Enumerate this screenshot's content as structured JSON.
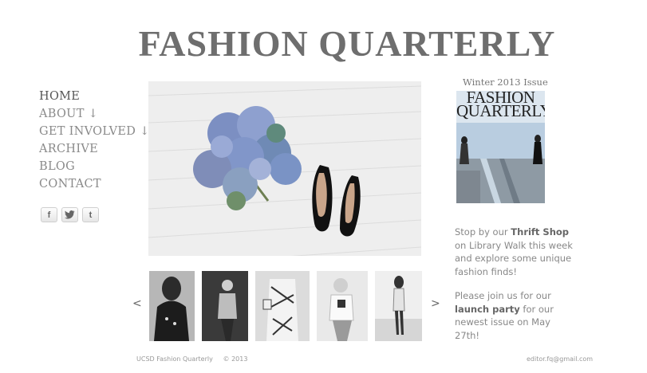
{
  "site": {
    "title": "FASHION QUARTERLY"
  },
  "nav": {
    "items": [
      {
        "label": "HOME"
      },
      {
        "label": "ABOUT ↓"
      },
      {
        "label": "GET INVOLVED ↓"
      },
      {
        "label": "ARCHIVE"
      },
      {
        "label": "BLOG"
      },
      {
        "label": "CONTACT"
      }
    ]
  },
  "social": {
    "facebook": "f",
    "twitter": "t",
    "tumblr": "t"
  },
  "carousel": {
    "prev": "<",
    "next": ">"
  },
  "sidebar": {
    "issue_label": "Winter 2013 Issue",
    "cover_title_line1": "FASHION",
    "cover_title_line2": "QUARTERLY",
    "thrift": {
      "pre": "Stop by our ",
      "bold": "Thrift Shop",
      "post": " on Library Walk this week and explore some unique fashion finds!"
    },
    "launch": {
      "pre": "Please join us for our ",
      "bold": "launch party",
      "post": " for our newest issue on May 27th!"
    }
  },
  "footer": {
    "name": "UCSD Fashion Quarterly",
    "copyright": "© 2013",
    "email": "editor.fq@gmail.com"
  },
  "colors": {
    "text": "#7a7a7a",
    "title": "#6e6e6e",
    "background": "#ffffff"
  }
}
